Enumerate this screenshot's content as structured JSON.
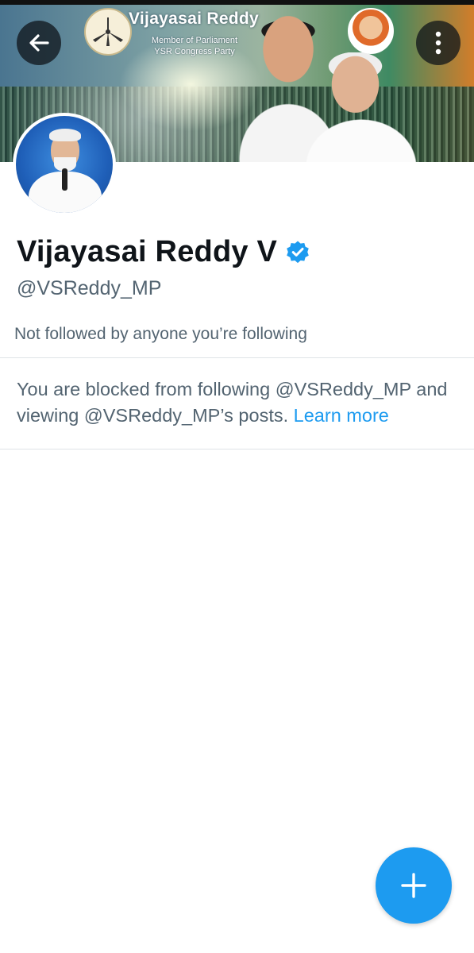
{
  "banner": {
    "title": "Vijayasai Reddy",
    "subtitle_line1": "Member of Parliament",
    "subtitle_line2": "YSR Congress Party"
  },
  "header": {
    "back_icon": "arrow-left-icon",
    "more_icon": "more-vertical-icon"
  },
  "profile": {
    "display_name": "Vijayasai Reddy V",
    "verified_icon": "verified-badge-icon",
    "verified_color": "#1d9bf0",
    "handle": "@VSReddy_MP",
    "followed_note": "Not followed by anyone you’re following"
  },
  "blocked_notice": {
    "text": "You are blocked from following @VSReddy_MP and viewing @VSReddy_MP’s posts.",
    "link_label": "Learn more",
    "link_color": "#1d9bf0"
  },
  "fab": {
    "icon": "plus-icon",
    "color": "#1d9bf0"
  }
}
